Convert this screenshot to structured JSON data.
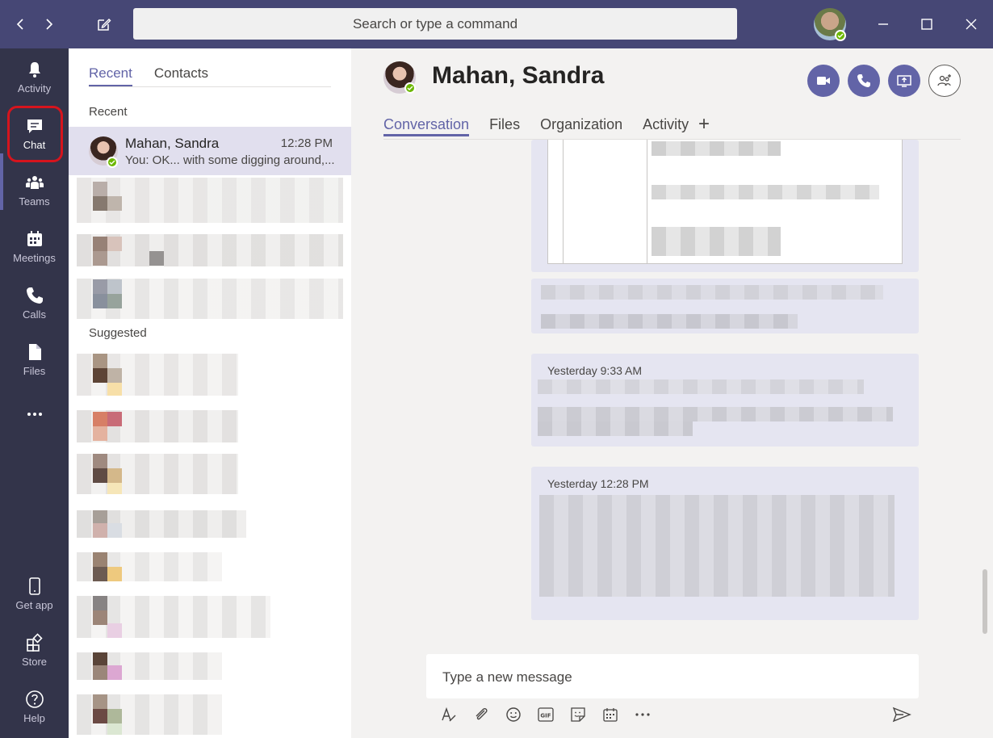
{
  "search": {
    "placeholder": "Search or type a command"
  },
  "rail": [
    {
      "label": "Activity",
      "icon": "bell-icon"
    },
    {
      "label": "Chat",
      "icon": "chat-icon"
    },
    {
      "label": "Teams",
      "icon": "teams-icon"
    },
    {
      "label": "Meetings",
      "icon": "calendar-icon"
    },
    {
      "label": "Calls",
      "icon": "phone-icon"
    },
    {
      "label": "Files",
      "icon": "file-icon"
    },
    {
      "label": "Get app",
      "icon": "phone-device-icon"
    },
    {
      "label": "Store",
      "icon": "store-icon"
    },
    {
      "label": "Help",
      "icon": "help-icon"
    }
  ],
  "list": {
    "tabs": [
      "Recent",
      "Contacts"
    ],
    "recent_label": "Recent",
    "suggested_label": "Suggested",
    "active_chat": {
      "name": "Mahan, Sandra",
      "time": "12:28 PM",
      "preview": "You: OK... with some digging around,..."
    }
  },
  "header": {
    "name": "Mahan, Sandra",
    "tabs": [
      "Conversation",
      "Files",
      "Organization",
      "Activity"
    ],
    "add_tab": "+"
  },
  "messages": [
    {
      "time": "Yesterday 9:33 AM"
    },
    {
      "time": "Yesterday 12:28 PM"
    }
  ],
  "compose": {
    "placeholder": "Type a new message"
  },
  "colors": {
    "brand": "#6264a7",
    "titlebar": "#464775",
    "rail": "#33344a",
    "presence": "#6bb700"
  }
}
